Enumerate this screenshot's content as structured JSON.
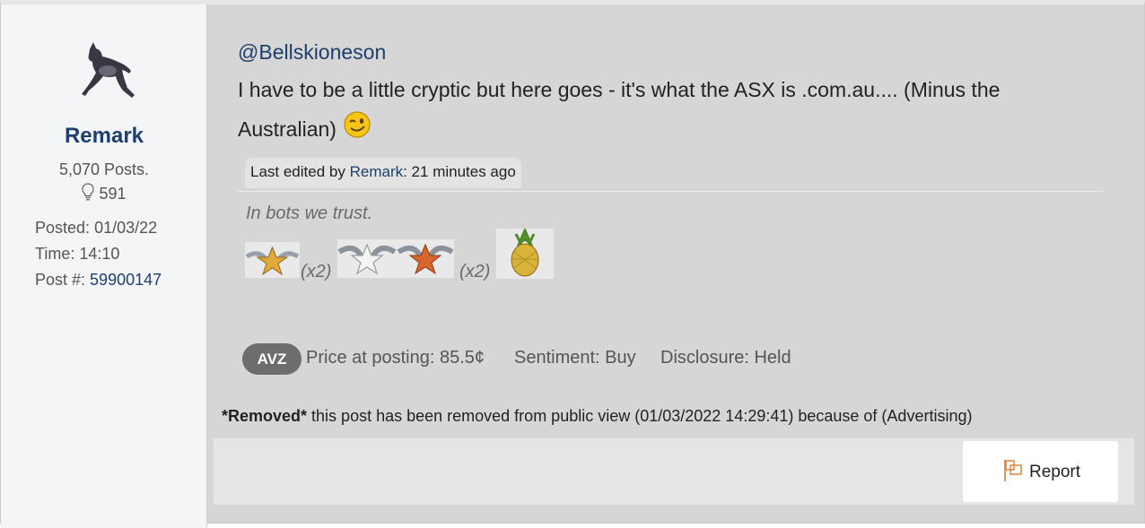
{
  "user": {
    "username": "Remark",
    "posts": "5,070 Posts.",
    "likes": "591",
    "posted_label": "Posted:",
    "posted_value": "01/03/22",
    "time_label": "Time:",
    "time_value": "14:10",
    "post_num_label": "Post #:",
    "post_num_value": "59900147"
  },
  "post": {
    "mention": "@Bellskioneson",
    "body_line1": "I have to be a little cryptic but here goes - it's what the ASX is .com.au.... (Minus the",
    "body_line2": "Australian)",
    "emoji": "wink-emoji",
    "edit_prefix": "Last edited by",
    "edit_user": "Remark",
    "edit_suffix": ": 21 minutes ago",
    "signature": "In bots we trust.",
    "badge_mult_1": "(x2)",
    "badge_mult_2": "(x2)"
  },
  "stock": {
    "ticker": "AVZ",
    "price": "Price at posting: 85.5¢",
    "sentiment": "Sentiment: Buy",
    "disclosure": "Disclosure: Held"
  },
  "removed": {
    "bold": "*Removed*",
    "text": " this post has been removed from public view (01/03/2022 14:29:41) because of (Advertising)"
  },
  "actions": {
    "report_label": "Report"
  },
  "colors": {
    "link": "#1e3f6e",
    "report_flag": "#e07b2e"
  }
}
